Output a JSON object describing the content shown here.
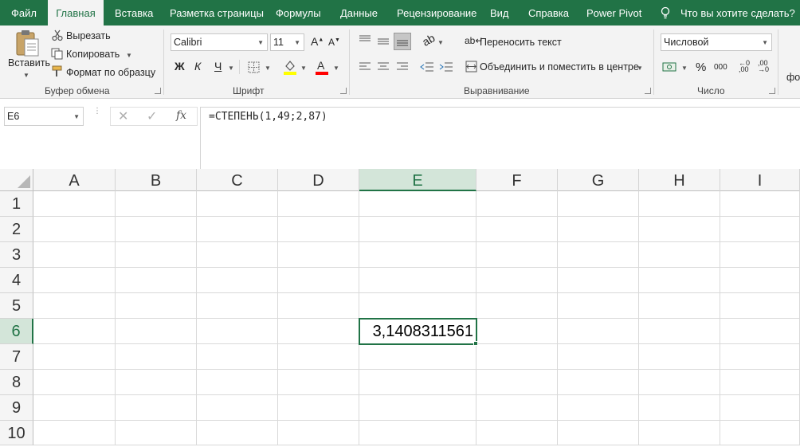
{
  "tabs": [
    {
      "label": "Файл",
      "active": false
    },
    {
      "label": "Главная",
      "active": true
    },
    {
      "label": "Вставка",
      "active": false
    },
    {
      "label": "Разметка страницы",
      "active": false
    },
    {
      "label": "Формулы",
      "active": false
    },
    {
      "label": "Данные",
      "active": false
    },
    {
      "label": "Рецензирование",
      "active": false
    },
    {
      "label": "Вид",
      "active": false
    },
    {
      "label": "Справка",
      "active": false
    },
    {
      "label": "Power Pivot",
      "active": false
    }
  ],
  "tell_me": "Что вы хотите сделать?",
  "clipboard": {
    "paste": "Вставить",
    "cut": "Вырезать",
    "copy": "Копировать",
    "format_painter": "Формат по образцу",
    "label": "Буфер обмена"
  },
  "font": {
    "name": "Calibri",
    "size": "11",
    "bold": "Ж",
    "italic": "К",
    "underline": "Ч",
    "label": "Шрифт"
  },
  "alignment": {
    "wrap": "Переносить текст",
    "merge": "Объединить и поместить в центре",
    "label": "Выравнивание"
  },
  "number": {
    "format": "Числовой",
    "percent": "%",
    "thousands": "000",
    "label": "Число"
  },
  "styles_cut": "фо",
  "namebox": "E6",
  "formula": "=СТЕПЕНЬ(1,49;2,87)",
  "columns": [
    "A",
    "B",
    "C",
    "D",
    "E",
    "F",
    "G",
    "H",
    "I"
  ],
  "selected_col": "E",
  "rows": [
    "1",
    "2",
    "3",
    "4",
    "5",
    "6",
    "7",
    "8",
    "9",
    "10"
  ],
  "selected_row": "6",
  "cell_value": "3,1408311561",
  "colors": {
    "accent": "#217346",
    "highlight": "#ffff00",
    "font_color": "#ff0000",
    "header_sel": "#d3e5d9"
  }
}
